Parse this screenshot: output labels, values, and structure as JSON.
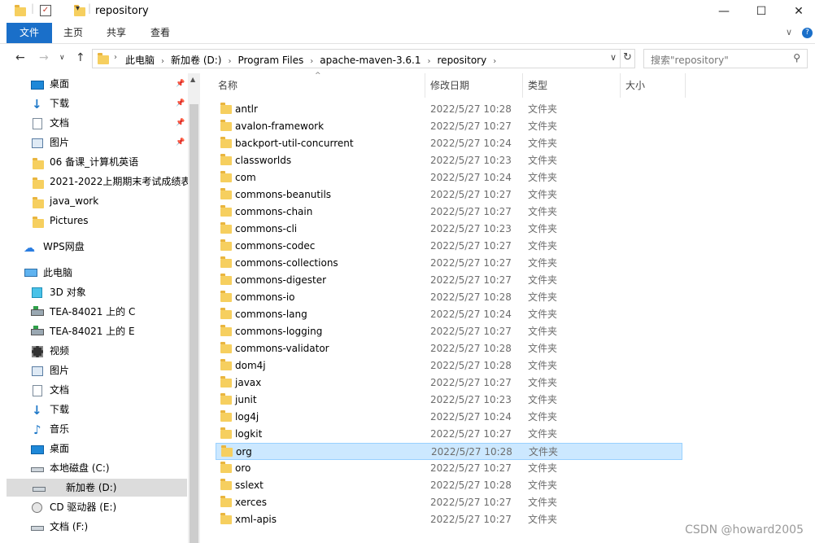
{
  "window": {
    "title": "repository",
    "minimize": "—",
    "maximize": "☐",
    "close": "✕"
  },
  "ribbon": {
    "tabs": [
      "文件",
      "主页",
      "共享",
      "查看"
    ]
  },
  "address": {
    "crumbs": [
      "此电脑",
      "新加卷 (D:)",
      "Program Files",
      "apache-maven-3.6.1",
      "repository"
    ],
    "search_placeholder": "搜索\"repository\""
  },
  "nav": {
    "items": [
      {
        "label": "桌面",
        "icon": "desktop-icon",
        "pinned": true
      },
      {
        "label": "下载",
        "icon": "download-icon",
        "pinned": true
      },
      {
        "label": "文档",
        "icon": "document-icon",
        "pinned": true
      },
      {
        "label": "图片",
        "icon": "picture-icon",
        "pinned": true
      },
      {
        "label": "06 备课_计算机英语",
        "icon": "folder-icon"
      },
      {
        "label": "2021-2022上期期末考试成绩表",
        "icon": "folder-icon"
      },
      {
        "label": "java_work",
        "icon": "folder-icon"
      },
      {
        "label": "Pictures",
        "icon": "folder-icon"
      },
      {
        "label": "WPS网盘",
        "icon": "cloud-icon"
      },
      {
        "label": "此电脑",
        "icon": "computer-icon"
      },
      {
        "label": "3D 对象",
        "icon": "cube-icon"
      },
      {
        "label": "TEA-84021 上的 C",
        "icon": "network-drive-icon"
      },
      {
        "label": "TEA-84021 上的 E",
        "icon": "network-drive-icon"
      },
      {
        "label": "视频",
        "icon": "video-icon"
      },
      {
        "label": "图片",
        "icon": "picture-icon"
      },
      {
        "label": "文档",
        "icon": "document-icon"
      },
      {
        "label": "下载",
        "icon": "download-icon"
      },
      {
        "label": "音乐",
        "icon": "music-icon"
      },
      {
        "label": "桌面",
        "icon": "desktop-icon"
      },
      {
        "label": "本地磁盘 (C:)",
        "icon": "drive-icon"
      },
      {
        "label": "新加卷 (D:)",
        "icon": "drive-icon",
        "selected": true
      },
      {
        "label": "CD 驱动器 (E:)",
        "icon": "cd-drive-icon"
      },
      {
        "label": "文档 (F:)",
        "icon": "drive-icon"
      }
    ]
  },
  "columns": {
    "name": "名称",
    "date": "修改日期",
    "type": "类型",
    "size": "大小"
  },
  "files": [
    {
      "name": "antlr",
      "date": "2022/5/27 10:28",
      "type": "文件夹"
    },
    {
      "name": "avalon-framework",
      "date": "2022/5/27 10:27",
      "type": "文件夹"
    },
    {
      "name": "backport-util-concurrent",
      "date": "2022/5/27 10:24",
      "type": "文件夹"
    },
    {
      "name": "classworlds",
      "date": "2022/5/27 10:23",
      "type": "文件夹"
    },
    {
      "name": "com",
      "date": "2022/5/27 10:24",
      "type": "文件夹"
    },
    {
      "name": "commons-beanutils",
      "date": "2022/5/27 10:27",
      "type": "文件夹"
    },
    {
      "name": "commons-chain",
      "date": "2022/5/27 10:27",
      "type": "文件夹"
    },
    {
      "name": "commons-cli",
      "date": "2022/5/27 10:23",
      "type": "文件夹"
    },
    {
      "name": "commons-codec",
      "date": "2022/5/27 10:27",
      "type": "文件夹"
    },
    {
      "name": "commons-collections",
      "date": "2022/5/27 10:27",
      "type": "文件夹"
    },
    {
      "name": "commons-digester",
      "date": "2022/5/27 10:27",
      "type": "文件夹"
    },
    {
      "name": "commons-io",
      "date": "2022/5/27 10:28",
      "type": "文件夹"
    },
    {
      "name": "commons-lang",
      "date": "2022/5/27 10:24",
      "type": "文件夹"
    },
    {
      "name": "commons-logging",
      "date": "2022/5/27 10:27",
      "type": "文件夹"
    },
    {
      "name": "commons-validator",
      "date": "2022/5/27 10:28",
      "type": "文件夹"
    },
    {
      "name": "dom4j",
      "date": "2022/5/27 10:28",
      "type": "文件夹"
    },
    {
      "name": "javax",
      "date": "2022/5/27 10:27",
      "type": "文件夹"
    },
    {
      "name": "junit",
      "date": "2022/5/27 10:23",
      "type": "文件夹"
    },
    {
      "name": "log4j",
      "date": "2022/5/27 10:24",
      "type": "文件夹"
    },
    {
      "name": "logkit",
      "date": "2022/5/27 10:27",
      "type": "文件夹"
    },
    {
      "name": "org",
      "date": "2022/5/27 10:28",
      "type": "文件夹",
      "selected": true
    },
    {
      "name": "oro",
      "date": "2022/5/27 10:27",
      "type": "文件夹"
    },
    {
      "name": "sslext",
      "date": "2022/5/27 10:28",
      "type": "文件夹"
    },
    {
      "name": "xerces",
      "date": "2022/5/27 10:27",
      "type": "文件夹"
    },
    {
      "name": "xml-apis",
      "date": "2022/5/27 10:27",
      "type": "文件夹"
    }
  ],
  "watermark": "CSDN @howard2005",
  "colors": {
    "accent": "#1a6fc9",
    "selection": "#cce8ff",
    "selection_border": "#99d1ff",
    "folder": "#f6cf5f"
  }
}
